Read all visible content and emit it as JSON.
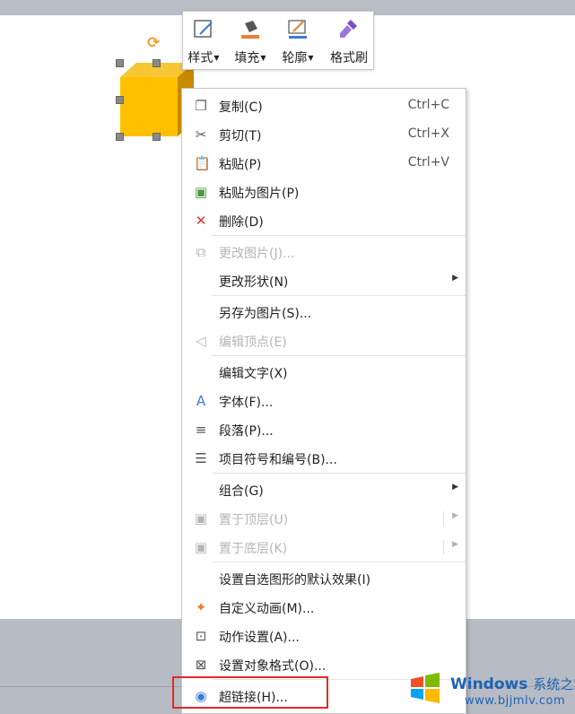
{
  "mini_toolbar": {
    "style": "样式",
    "fill": "填充",
    "outline": "轮廓",
    "format_painter": "格式刷"
  },
  "menu": {
    "copy": {
      "label": "复制(C)",
      "shortcut": "Ctrl+C"
    },
    "cut": {
      "label": "剪切(T)",
      "shortcut": "Ctrl+X"
    },
    "paste": {
      "label": "粘贴(P)",
      "shortcut": "Ctrl+V"
    },
    "paste_as_picture": "粘贴为图片(P)",
    "delete": "删除(D)",
    "change_picture": "更改图片(J)...",
    "change_shape": "更改形状(N)",
    "save_as_picture": "另存为图片(S)...",
    "edit_points": "编辑顶点(E)",
    "edit_text": "编辑文字(X)",
    "font": "字体(F)...",
    "paragraph": "段落(P)...",
    "bullets": "项目符号和编号(B)...",
    "group": "组合(G)",
    "bring_to_front": "置于顶层(U)",
    "send_to_back": "置于底层(K)",
    "set_default": "设置自选图形的默认效果(I)",
    "custom_animation": "自定义动画(M)...",
    "action_settings": "动作设置(A)...",
    "format_object": "设置对象格式(O)...",
    "hyperlink": "超链接(H)..."
  },
  "watermark": {
    "title": "Windows",
    "title_cn": "系统之家",
    "url": "www.bjjmlv.com"
  },
  "colors": {
    "shape_fill": "#FFC000",
    "highlight": "#E02A2A",
    "accent": "#1E63B4"
  }
}
